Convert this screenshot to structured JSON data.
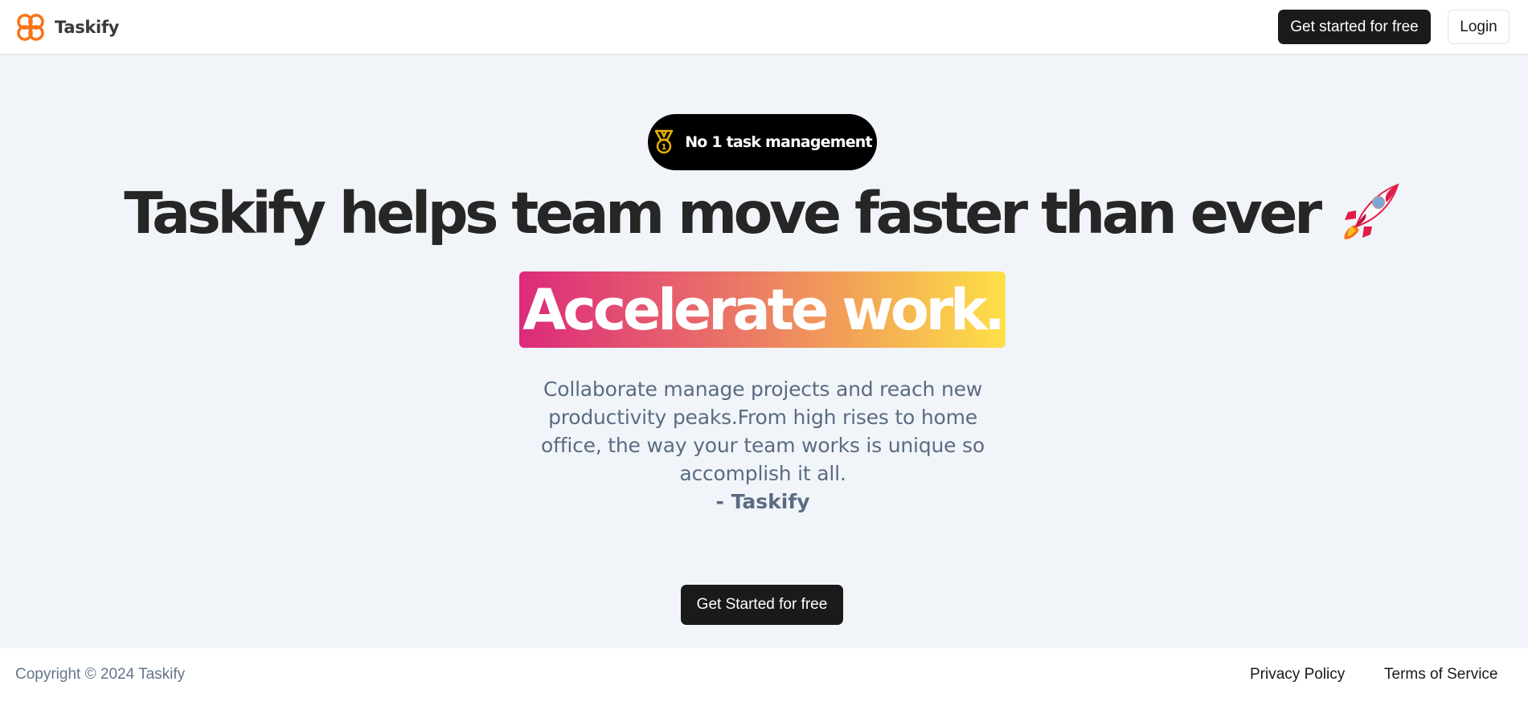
{
  "header": {
    "brand_name": "Taskify",
    "cta_label": "Get started for free",
    "login_label": "Login"
  },
  "hero": {
    "badge_label": "No 1 task management",
    "headline": "Taskify helps team move faster than ever",
    "accent_text": "Accelerate work.",
    "tagline": "Collaborate manage projects and reach new productivity peaks.From high rises to home office, the way your team works is unique so accomplish it all.",
    "signature": "- Taskify",
    "cta_label": "Get Started for free"
  },
  "footer": {
    "copyright": "Copyright © 2024 Taskify",
    "links": [
      {
        "label": "Privacy Policy"
      },
      {
        "label": "Terms of Service"
      }
    ]
  },
  "icons": {
    "logo": "taskify-logo-icon",
    "badge": "medal-icon",
    "headline": "rocket-icon"
  },
  "colors": {
    "brand_orange": "#f97316",
    "dark_button": "#1a1a1a",
    "page_background": "#f1f5f9",
    "muted_text": "#5b6b82",
    "gradient_start": "#dc2a7a",
    "gradient_end": "#fde047",
    "badge_icon": "#eab308"
  }
}
